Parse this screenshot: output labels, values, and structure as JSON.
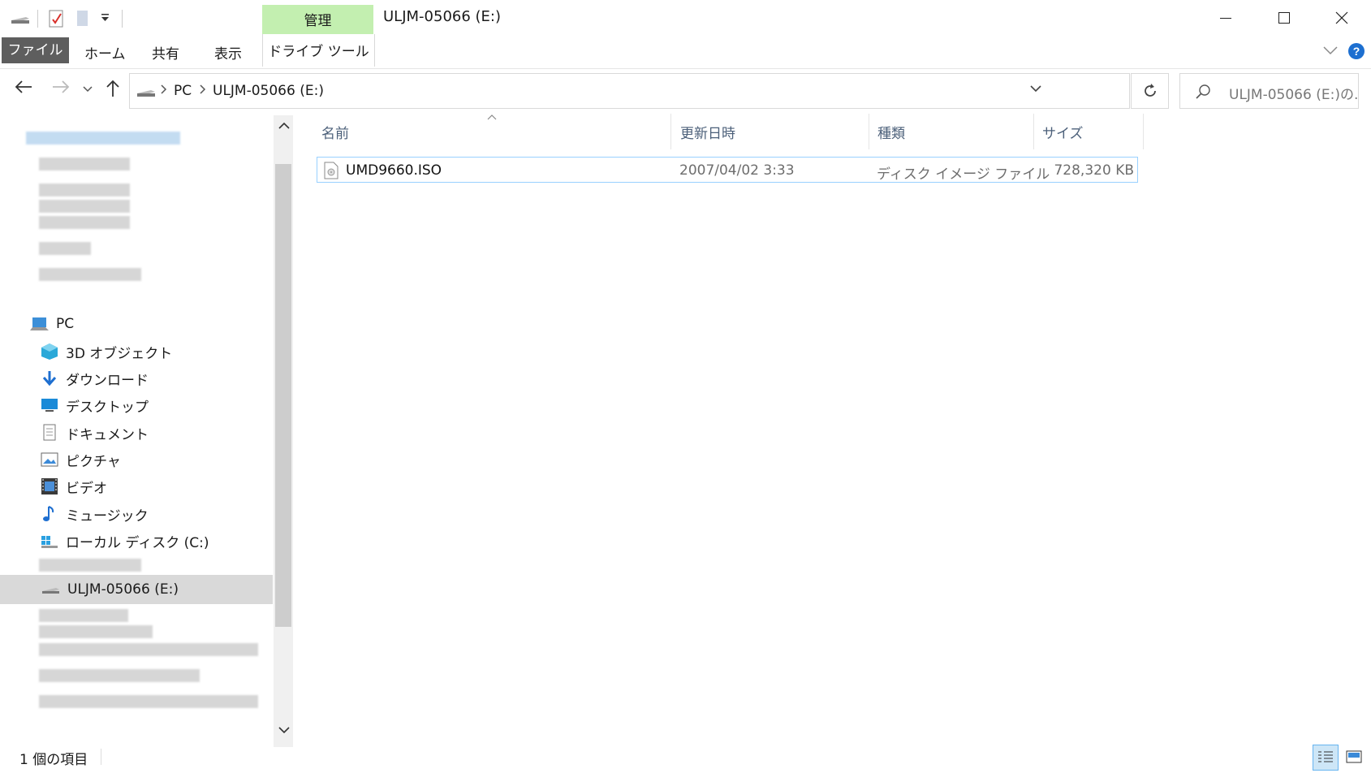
{
  "window": {
    "title": "ULJM-05066 (E:)",
    "context_tab_group": "管理",
    "controls": [
      "minimize-icon",
      "maximize-icon",
      "close-icon"
    ]
  },
  "ribbon": {
    "tabs": [
      "ファイル",
      "ホーム",
      "共有",
      "表示",
      "ドライブ ツール"
    ],
    "help_icon": "help-icon"
  },
  "address": {
    "breadcrumbs": [
      "PC",
      "ULJM-05066 (E:)"
    ],
    "search_placeholder": "ULJM-05066 (E:)の..."
  },
  "navigation": {
    "items": [
      {
        "label": "PC",
        "icon": "pc-icon"
      },
      {
        "label": "3D オブジェクト",
        "icon": "3d-objects-icon"
      },
      {
        "label": "ダウンロード",
        "icon": "download-icon"
      },
      {
        "label": "デスクトップ",
        "icon": "desktop-icon"
      },
      {
        "label": "ドキュメント",
        "icon": "document-icon"
      },
      {
        "label": "ピクチャ",
        "icon": "pictures-icon"
      },
      {
        "label": "ビデオ",
        "icon": "video-icon"
      },
      {
        "label": "ミュージック",
        "icon": "music-icon"
      },
      {
        "label": "ローカル ディスク (C:)",
        "icon": "local-disk-icon"
      },
      {
        "label": "ULJM-05066 (E:)",
        "icon": "disc-drive-icon",
        "selected": true
      }
    ]
  },
  "file_list": {
    "columns": [
      "名前",
      "更新日時",
      "種類",
      "サイズ"
    ],
    "rows": [
      {
        "name": "UMD9660.ISO",
        "date": "2007/04/02 3:33",
        "type": "ディスク イメージ ファイル",
        "size": "728,320 KB"
      }
    ]
  },
  "status_bar": {
    "count": "1 個の項目"
  }
}
